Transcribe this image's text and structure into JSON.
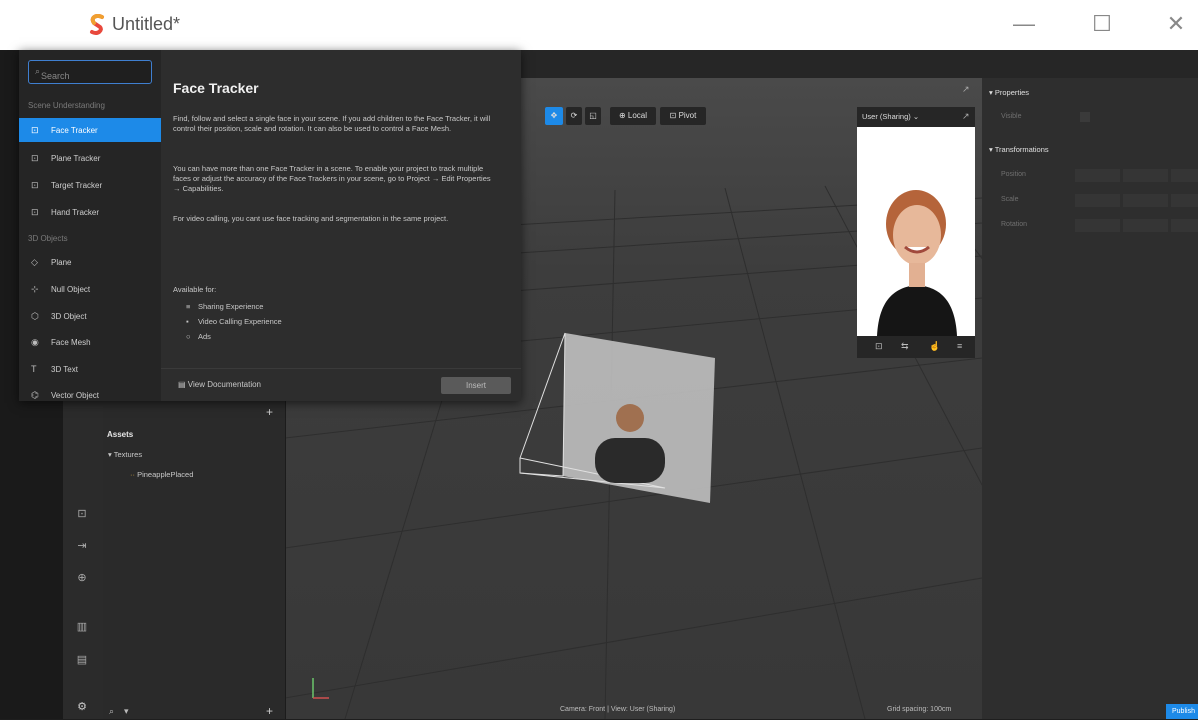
{
  "window": {
    "title": "Untitled*",
    "minimize": "—",
    "maximize": "☐",
    "close": "✕"
  },
  "add_dialog": {
    "search_placeholder": "Search",
    "categories": [
      {
        "label": "Scene Understanding"
      },
      {
        "label": "3D Objects"
      }
    ],
    "items": [
      {
        "label": "Face Tracker",
        "icon": "face-tracker-icon",
        "selected": true
      },
      {
        "label": "Plane Tracker",
        "icon": "plane-tracker-icon"
      },
      {
        "label": "Target Tracker",
        "icon": "target-tracker-icon"
      },
      {
        "label": "Hand Tracker",
        "icon": "hand-tracker-icon"
      },
      {
        "label": "Plane",
        "icon": "plane-icon"
      },
      {
        "label": "Null Object",
        "icon": "null-object-icon"
      },
      {
        "label": "3D Object",
        "icon": "3d-object-icon"
      },
      {
        "label": "Face Mesh",
        "icon": "face-mesh-icon"
      },
      {
        "label": "3D Text",
        "icon": "3d-text-icon"
      },
      {
        "label": "Vector Object",
        "icon": "vector-object-icon"
      }
    ],
    "detail": {
      "title": "Face Tracker",
      "para1": "Find, follow and select a single face in your scene. If you add children to the Face Tracker, it will control their position, scale and rotation. It can also be used to control a Face Mesh.",
      "para2": "You can have more than one Face Tracker in a scene. To enable your project to track multiple faces or adjust the accuracy of the Face Trackers in your scene, go to Project → Edit Properties → Capabilities.",
      "para3": "For video calling, you cant use face tracking and segmentation in the same project.",
      "available_label": "Available for:",
      "available": [
        "Sharing Experience",
        "Video Calling Experience",
        "Ads"
      ]
    },
    "view_documentation": "View Documentation",
    "insert_label": "Insert"
  },
  "viewport": {
    "toolbar": {
      "local_label": "Local",
      "pivot_label": "Pivot"
    },
    "preview_label": "User (Sharing)",
    "camera_status": "Camera: Front | View: User (Sharing)",
    "grid_status": "Grid spacing: 100cm"
  },
  "assets": {
    "title": "Assets",
    "folder": "Textures",
    "file": "PineapplePlaced"
  },
  "properties": {
    "header": "Properties",
    "visible_label": "Visible",
    "transformations": "Transformations",
    "rows": [
      "Position",
      "Scale",
      "Rotation"
    ]
  },
  "publish_label": "Publish",
  "colors": {
    "accent": "#1d8ae8",
    "viewport_bg": "#3a3a3a",
    "panel_bg": "#2d2d2d"
  }
}
